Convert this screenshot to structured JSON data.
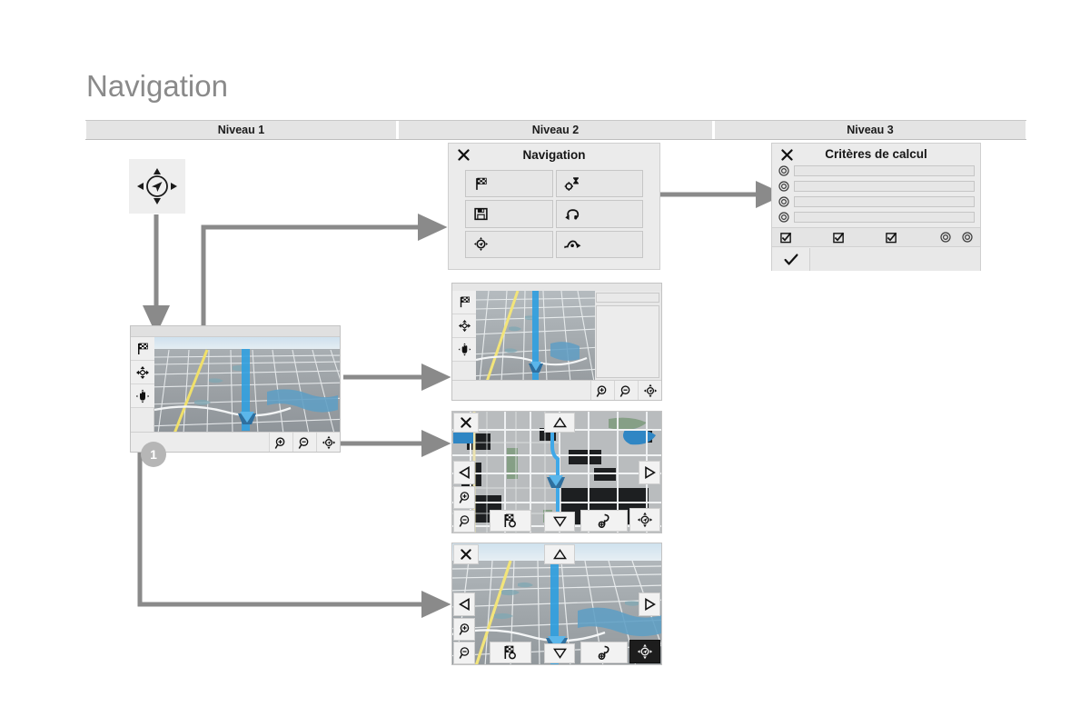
{
  "page": {
    "title": "Navigation",
    "background": "#ffffff",
    "accent_gray": "#7f7f7f",
    "header_bg": "#e4e4e4"
  },
  "level_header": {
    "columns": [
      {
        "label": "Niveau 1"
      },
      {
        "label": "Niveau 2"
      },
      {
        "label": "Niveau 3"
      }
    ]
  },
  "niveau1": {
    "nav_pad": {
      "icon": "navigation-compass-pad-icon",
      "up": "up-arrow-icon",
      "down": "down-arrow-icon",
      "left": "left-arrow-icon",
      "right": "right-arrow-icon",
      "center": "navigation-cursor-icon"
    },
    "map_main": {
      "name": "map-3d-perspective",
      "left_buttons": [
        {
          "icon": "checkered-flag-icon",
          "name": "destination-button"
        },
        {
          "icon": "pan-arrows-icon",
          "name": "pan-mode-button"
        },
        {
          "icon": "hand-drag-icon",
          "name": "drag-mode-button"
        }
      ],
      "bottom_buttons": [
        {
          "icon": "zoom-in-icon",
          "name": "zoom-in-button"
        },
        {
          "icon": "zoom-out-icon",
          "name": "zoom-out-button"
        },
        {
          "icon": "compass-orientation-icon",
          "name": "orientation-button"
        }
      ]
    },
    "callout": {
      "number": "1"
    }
  },
  "niveau2": {
    "dialog_navigation": {
      "title": "Navigation",
      "close_icon": "close-x-icon",
      "tiles": [
        {
          "icon": "checkered-flag-icon",
          "name": "tile-destination"
        },
        {
          "icon": "calculation-criteria-icon",
          "name": "tile-criteres-de-calcul"
        },
        {
          "icon": "save-floppy-icon",
          "name": "tile-save-destination"
        },
        {
          "icon": "traffic-info-icon",
          "name": "tile-traffic-info"
        },
        {
          "icon": "navigation-cursor-icon",
          "name": "tile-guidance"
        },
        {
          "icon": "route-detour-icon",
          "name": "tile-detour"
        }
      ]
    },
    "map_with_panel": {
      "name": "map-with-side-panel",
      "left_buttons": [
        {
          "icon": "checkered-flag-icon",
          "name": "destination-button"
        },
        {
          "icon": "pan-arrows-icon",
          "name": "pan-mode-button"
        },
        {
          "icon": "hand-drag-icon",
          "name": "drag-mode-button"
        }
      ],
      "bottom_buttons": [
        {
          "icon": "zoom-in-icon",
          "name": "zoom-in-button"
        },
        {
          "icon": "zoom-out-icon",
          "name": "zoom-out-button"
        },
        {
          "icon": "compass-orientation-icon",
          "name": "orientation-button"
        }
      ],
      "panel_fields": [
        "",
        ""
      ]
    },
    "map_2d": {
      "name": "map-2d-top-view",
      "close_icon": "close-x-icon",
      "buttons": [
        {
          "icon": "up-triangle-icon",
          "name": "scroll-up-button"
        },
        {
          "icon": "down-triangle-icon",
          "name": "scroll-down-button"
        },
        {
          "icon": "left-triangle-icon",
          "name": "scroll-left-button"
        },
        {
          "icon": "right-triangle-icon",
          "name": "scroll-right-button"
        },
        {
          "icon": "zoom-in-icon",
          "name": "zoom-in-button"
        },
        {
          "icon": "zoom-out-icon",
          "name": "zoom-out-button"
        },
        {
          "icon": "checkered-flag-icon",
          "name": "destination-button"
        },
        {
          "icon": "poi-pin-icon",
          "name": "poi-button"
        },
        {
          "icon": "compass-orientation-icon",
          "name": "orientation-button"
        }
      ]
    },
    "map_3d": {
      "name": "map-3d-bird-view",
      "close_icon": "close-x-icon",
      "buttons": [
        {
          "icon": "up-triangle-icon",
          "name": "scroll-up-button"
        },
        {
          "icon": "down-triangle-icon",
          "name": "scroll-down-button"
        },
        {
          "icon": "left-triangle-icon",
          "name": "scroll-left-button"
        },
        {
          "icon": "right-triangle-icon",
          "name": "scroll-right-button"
        },
        {
          "icon": "zoom-in-icon",
          "name": "zoom-in-button"
        },
        {
          "icon": "zoom-out-icon",
          "name": "zoom-out-button"
        },
        {
          "icon": "checkered-flag-icon",
          "name": "destination-button"
        },
        {
          "icon": "poi-pin-icon",
          "name": "poi-button"
        },
        {
          "icon": "compass-orientation-icon",
          "name": "orientation-button"
        }
      ]
    }
  },
  "niveau3": {
    "dialog_criteres": {
      "title": "Critères de calcul",
      "close_icon": "close-x-icon",
      "options": [
        {
          "radio": "radio-icon",
          "value": ""
        },
        {
          "radio": "radio-icon",
          "value": ""
        },
        {
          "radio": "radio-icon",
          "value": ""
        },
        {
          "radio": "radio-icon",
          "value": ""
        }
      ],
      "toolbar": [
        {
          "icon": "checkbox-checked-icon",
          "name": "criteria-toggle-1"
        },
        {
          "icon": "checkbox-checked-icon",
          "name": "criteria-toggle-2"
        },
        {
          "icon": "checkbox-checked-icon",
          "name": "criteria-toggle-3"
        },
        {
          "icon": "radio-icon",
          "name": "criteria-radio-a"
        },
        {
          "icon": "radio-icon",
          "name": "criteria-radio-b"
        }
      ],
      "confirm": {
        "icon": "checkmark-icon",
        "name": "confirm-button"
      }
    }
  },
  "connectors": {
    "color": "#7f7f7f",
    "arrows": [
      {
        "name": "arrow-navpad-to-map-main"
      },
      {
        "name": "arrow-map-main-to-dialog-navigation"
      },
      {
        "name": "arrow-map-main-to-map-with-panel"
      },
      {
        "name": "arrow-map-main-to-map-2d"
      },
      {
        "name": "arrow-callout1-to-map-3d"
      },
      {
        "name": "arrow-criteres-tile-to-dialog-criteres"
      }
    ]
  }
}
